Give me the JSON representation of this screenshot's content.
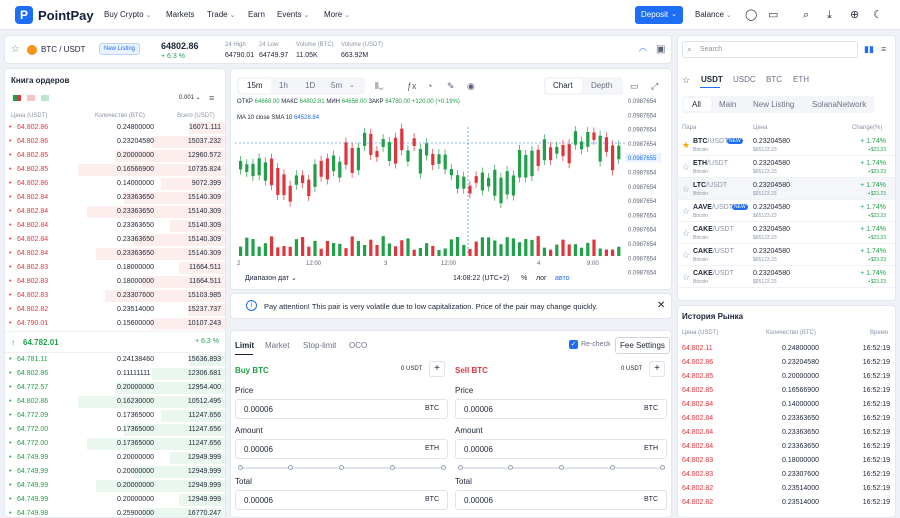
{
  "app": {
    "name": "PointPay"
  },
  "nav": {
    "items": [
      "Buy Crypto",
      "Markets",
      "Trade",
      "Earn",
      "Events",
      "More"
    ],
    "deposit": "Deposit",
    "balance": "Balance"
  },
  "ticker": {
    "pair": "BTC / USDT",
    "badge": "New Listing",
    "price": "64802.86",
    "change": "+ 6.3 %",
    "stats": [
      {
        "label": "24 High",
        "value": "64790.01"
      },
      {
        "label": "24 Low",
        "value": "64749.97"
      },
      {
        "label": "Volume (BTC)",
        "value": "11.05K"
      },
      {
        "label": "Volume (USDT)",
        "value": "663.92M"
      }
    ]
  },
  "orderbook": {
    "title": "Книга ордеров",
    "precision": "0.001",
    "cols": [
      "Цена (USDT)",
      "Количество (BTC)",
      "Всего (USDT)"
    ],
    "asks": [
      [
        "64.802.86",
        "0.24800000",
        "16071.111"
      ],
      [
        "64.802.86",
        "0.23204580",
        "15037.232"
      ],
      [
        "64.802.85",
        "0.20000000",
        "12960.572"
      ],
      [
        "64.802.85",
        "0.16566900",
        "10735.824"
      ],
      [
        "64.802.86",
        "0.14000000",
        "9072.399"
      ],
      [
        "64.802.84",
        "0.23363650",
        "15140.309"
      ],
      [
        "64.802.84",
        "0.23363650",
        "15140.309"
      ],
      [
        "64.802.84",
        "0.23363650",
        "15140.309"
      ],
      [
        "64.802.84",
        "0.23363650",
        "15140.309"
      ],
      [
        "64.802.84",
        "0.23363650",
        "15140.309"
      ],
      [
        "64.802.83",
        "0.18000000",
        "11664.511"
      ],
      [
        "64.802.83",
        "0.18000000",
        "11664.511"
      ],
      [
        "64.802.83",
        "0.23307600",
        "15103.985"
      ],
      [
        "64.802.82",
        "0.23514000",
        "15237.737"
      ],
      [
        "64.790.01",
        "0.15600000",
        "10107.243"
      ]
    ],
    "mid_price": "64.782.01",
    "mid_change": "+ 6.3 %",
    "bids": [
      [
        "64.781.11",
        "0.24138460",
        "15636.893"
      ],
      [
        "64.802.86",
        "0.11111111",
        "12306.681"
      ],
      [
        "64.772.57",
        "0.20000000",
        "12954.400"
      ],
      [
        "64.802.86",
        "0.16230000",
        "10512.495"
      ],
      [
        "64.772.09",
        "0.17365000",
        "11247.656"
      ],
      [
        "64.772.00",
        "0.17365000",
        "11247.656"
      ],
      [
        "64.772.00",
        "0.17365000",
        "11247.656"
      ],
      [
        "64.749.99",
        "0.20000000",
        "12949.999"
      ],
      [
        "64.749.99",
        "0.20000000",
        "12949.999"
      ],
      [
        "64.749.99",
        "0.20000000",
        "12949.999"
      ],
      [
        "64.749.99",
        "0.20000000",
        "12949.999"
      ],
      [
        "64.749.98",
        "0.25900000",
        "16770.247"
      ]
    ]
  },
  "chart": {
    "intervals": [
      "15m",
      "1h",
      "1D",
      "5m"
    ],
    "modes": [
      "Chart",
      "Depth"
    ],
    "ohlc": {
      "open_l": "ОТКР",
      "open": "64660.00",
      "high_l": "МАКС",
      "high": "64802.81",
      "low_l": "МИН",
      "low": "64656.00",
      "close_l": "ЗАКР",
      "close": "64780.00",
      "chg": "+120.00 (+0.19%)"
    },
    "ma": "MA 10 close SMA 10",
    "ma_val": "64528.84",
    "price_scale": [
      "0.0987654",
      "0.0987654",
      "0.0987654",
      "0.0987654",
      "0.0987655",
      "0.0987654",
      "0.0987654",
      "0.0987654",
      "0.0987654",
      "0.0987654",
      "0.0987654",
      "0.0987654",
      "0.0987654"
    ],
    "time_labels": [
      "2",
      "12:00",
      "3",
      "12:00",
      "4",
      "9:00"
    ],
    "range": "Диапазон дат",
    "clock": "14:08:22 (UTC+2)",
    "pct": "%",
    "log": "лог",
    "auto": "авто"
  },
  "notice": "Pay attention! This pair is very volatile due to low capitalization. Price of the pair may change quickly.",
  "order": {
    "tabs": [
      "Limit",
      "Market",
      "Stop-limit",
      "OCO"
    ],
    "recheck": "Re-check",
    "fee": "Fee Settings",
    "buy": {
      "title": "Buy BTC",
      "avail": "0 USDT",
      "price_l": "Price",
      "price": "0.00006",
      "price_u": "BTC",
      "amount_l": "Amount",
      "amount": "0.00006",
      "amount_u": "ETH",
      "total_l": "Total",
      "total": "0.00006",
      "total_u": "BTC"
    },
    "sell": {
      "title": "Sell BTC",
      "avail": "0 USDT",
      "price_l": "Price",
      "price": "0.00006",
      "price_u": "BTC",
      "amount_l": "Amount",
      "amount": "0.00006",
      "amount_u": "ETH",
      "total_l": "Total",
      "total": "0.00006",
      "total_u": "BTC"
    }
  },
  "markets": {
    "search": "Search",
    "quotes": [
      "USDT",
      "USDC",
      "BTC",
      "ETH"
    ],
    "filters": [
      "All",
      "Main",
      "New Listing",
      "SolanaNetwork"
    ],
    "cols": [
      "Пара",
      "Цена",
      "Change(%)"
    ],
    "rows": [
      {
        "pair": "BTC",
        "quote": "/USDT",
        "sub": "Bitcoin",
        "new": "NEW",
        "price": "0.23204580",
        "usd": "$65123.23",
        "chg": "+ 1.74%",
        "chg2": "+$23.23",
        "fav": true
      },
      {
        "pair": "ETH",
        "quote": "/USDT",
        "sub": "Bitcoin",
        "new": "",
        "price": "0.23204580",
        "usd": "$65123.23",
        "chg": "+ 1.74%",
        "chg2": "+$23.23",
        "fav": false
      },
      {
        "pair": "LTC",
        "quote": "/USDT",
        "sub": "Bitcoin",
        "new": "",
        "price": "0.23204580",
        "usd": "$65123.23",
        "chg": "+ 1.74%",
        "chg2": "+$23.23",
        "fav": false
      },
      {
        "pair": "AAVE",
        "quote": "/USDT",
        "sub": "Bitcoin",
        "new": "NEW",
        "price": "0.23204580",
        "usd": "$65123.23",
        "chg": "+ 1.74%",
        "chg2": "+$23.23",
        "fav": false
      },
      {
        "pair": "CAKE",
        "quote": "/USDT",
        "sub": "Bitcoin",
        "new": "",
        "price": "0.23204580",
        "usd": "$65123.23",
        "chg": "+ 1.74%",
        "chg2": "+$23.23",
        "fav": false
      },
      {
        "pair": "CAKE",
        "quote": "/USDT",
        "sub": "Bitcoin",
        "new": "",
        "price": "0.23204580",
        "usd": "$65123.23",
        "chg": "+ 1.74%",
        "chg2": "+$23.23",
        "fav": false
      },
      {
        "pair": "CAKE",
        "quote": "/USDT",
        "sub": "Bitcoin",
        "new": "",
        "price": "0.23204580",
        "usd": "$65123.23",
        "chg": "+ 1.74%",
        "chg2": "+$23.23",
        "fav": false
      }
    ]
  },
  "trades": {
    "title": "История Рынка",
    "cols": [
      "Цена (USDT)",
      "Количество (BTC)",
      "Время"
    ],
    "rows": [
      [
        "64.802.11",
        "0.24800000",
        "16:52:19"
      ],
      [
        "64.802.86",
        "0.23204580",
        "16:52:19"
      ],
      [
        "64.802.85",
        "0.20000000",
        "16:52:19"
      ],
      [
        "64.802.85",
        "0.16566900",
        "16:52:19"
      ],
      [
        "64.802.84",
        "0.14000000",
        "16:52:19"
      ],
      [
        "64.802.84",
        "0.23363650",
        "16:52:19"
      ],
      [
        "64.802.84",
        "0.23363650",
        "16:52:19"
      ],
      [
        "64.802.84",
        "0.23363650",
        "16:52:19"
      ],
      [
        "64.802.83",
        "0.18000000",
        "16:52:19"
      ],
      [
        "64.802.83",
        "0.23307600",
        "16:52:19"
      ],
      [
        "64.802.82",
        "0.23514000",
        "16:52:19"
      ],
      [
        "64.802.82",
        "0.23514000",
        "16:52:19"
      ]
    ]
  },
  "colors": {
    "accent": "#1d6ef5",
    "up": "#21a04b",
    "down": "#e0353d"
  }
}
